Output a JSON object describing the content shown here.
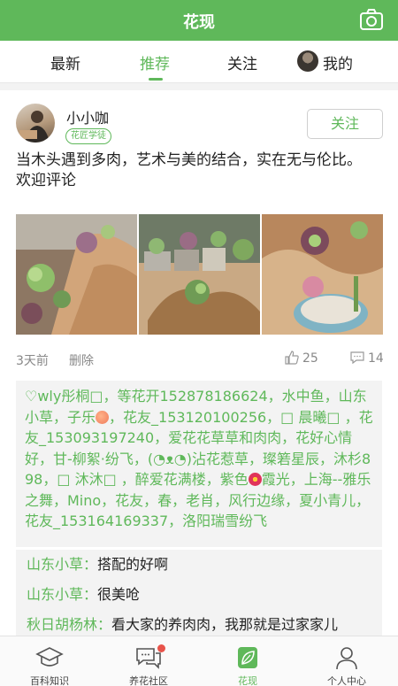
{
  "header": {
    "title": "花现",
    "camera_icon": "camera-icon"
  },
  "tabs": [
    {
      "label": "最新"
    },
    {
      "label": "推荐",
      "active": true
    },
    {
      "label": "关注"
    },
    {
      "label": "我的"
    }
  ],
  "post": {
    "author": "小小咖",
    "badge": "花匠学徒",
    "follow_label": "关注",
    "text": "当木头遇到多肉，艺术与美的结合，实在无与伦比。\n欢迎评论",
    "time": "3天前",
    "delete_label": "删除",
    "likes": "25",
    "comments_count": "14"
  },
  "likes_list": {
    "part1": "♡wly彤桐□，等花开152878186624，水中鱼，山东小草，子乐",
    "part2": "，花友_153120100256，□ 晨曦□ ，花友_153093197240，爱花花草草和肉肉，花好心情好，甘-柳絮·纷飞，(◔ᴥ◔)沾花惹草，璨箬星辰，沐杉898，□ 沐沐□ ，醉爱花满楼，紫色",
    "part3": "霞光，上海--雅乐之舞，Mino，花友，春，老肖，风行边缘，夏小青儿，花友_153164169337，洛阳瑞雪纷飞"
  },
  "comments": [
    {
      "user": "山东小草：",
      "text": "搭配的好啊"
    },
    {
      "user": "山东小草：",
      "text": "很美呛"
    },
    {
      "user": "秋日胡杨林：",
      "text": "看大家的养肉肉，我那就是过家家儿"
    }
  ],
  "bottom_nav": [
    {
      "label": "百科知识",
      "icon": "graduation-cap-icon"
    },
    {
      "label": "养花社区",
      "icon": "chat-bubbles-icon",
      "badge_dot": true
    },
    {
      "label": "花现",
      "icon": "leaf-icon",
      "active": true
    },
    {
      "label": "个人中心",
      "icon": "person-icon"
    }
  ],
  "colors": {
    "accent": "#5fb85a",
    "badge_red": "#e8534a"
  }
}
